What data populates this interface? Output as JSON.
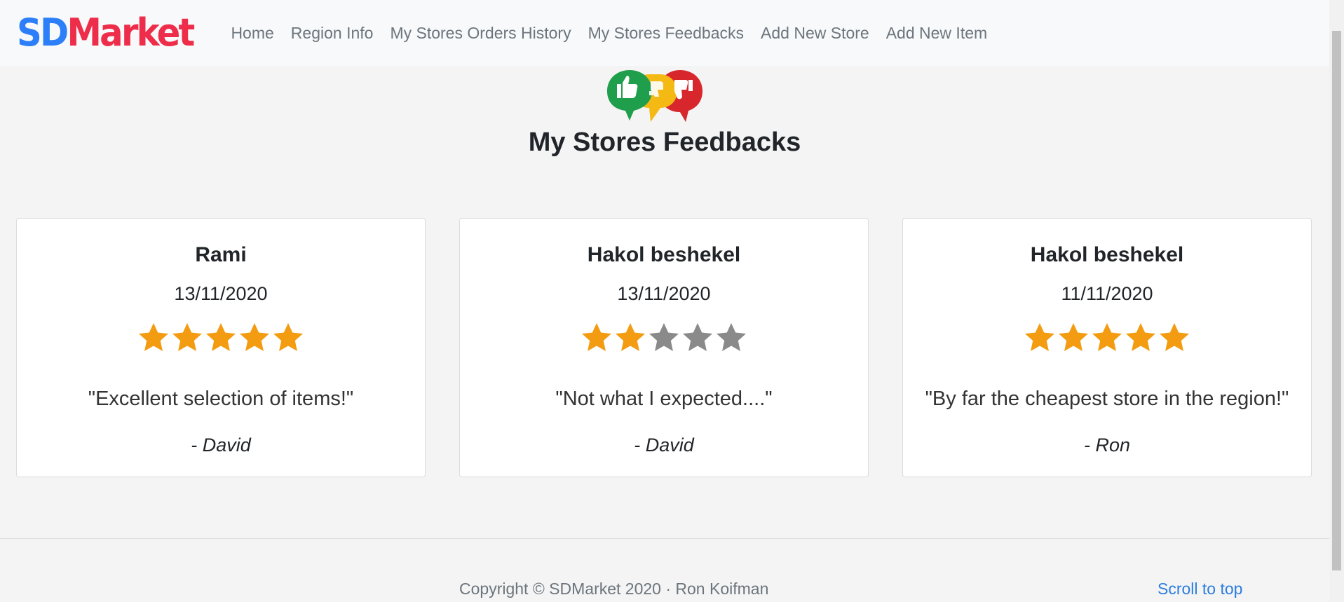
{
  "brand": {
    "part1": "SD",
    "part2": "Market"
  },
  "nav": [
    {
      "label": "Home"
    },
    {
      "label": "Region Info"
    },
    {
      "label": "My Stores Orders History"
    },
    {
      "label": "My Stores Feedbacks"
    },
    {
      "label": "Add New Store"
    },
    {
      "label": "Add New Item"
    }
  ],
  "page_title": "My Stores Feedbacks",
  "feedbacks": [
    {
      "store": "Rami",
      "date": "13/11/2020",
      "rating": 5,
      "max_rating": 5,
      "comment": "\"Excellent selection of items!\"",
      "author": "- David"
    },
    {
      "store": "Hakol beshekel",
      "date": "13/11/2020",
      "rating": 2,
      "max_rating": 5,
      "comment": "\"Not what I expected....\"",
      "author": "- David"
    },
    {
      "store": "Hakol beshekel",
      "date": "11/11/2020",
      "rating": 5,
      "max_rating": 5,
      "comment": "\"By far the cheapest store in the region!\"",
      "author": "- Ron"
    }
  ],
  "footer": {
    "copyright": "Copyright © SDMarket 2020 · Ron Koifman",
    "scroll_top": "Scroll to top"
  },
  "colors": {
    "star_filled": "#f39c12",
    "star_empty": "#8a8a8a",
    "brand_blue": "#2d7ff9",
    "brand_red": "#ed2d49",
    "link": "#2b7de0"
  }
}
